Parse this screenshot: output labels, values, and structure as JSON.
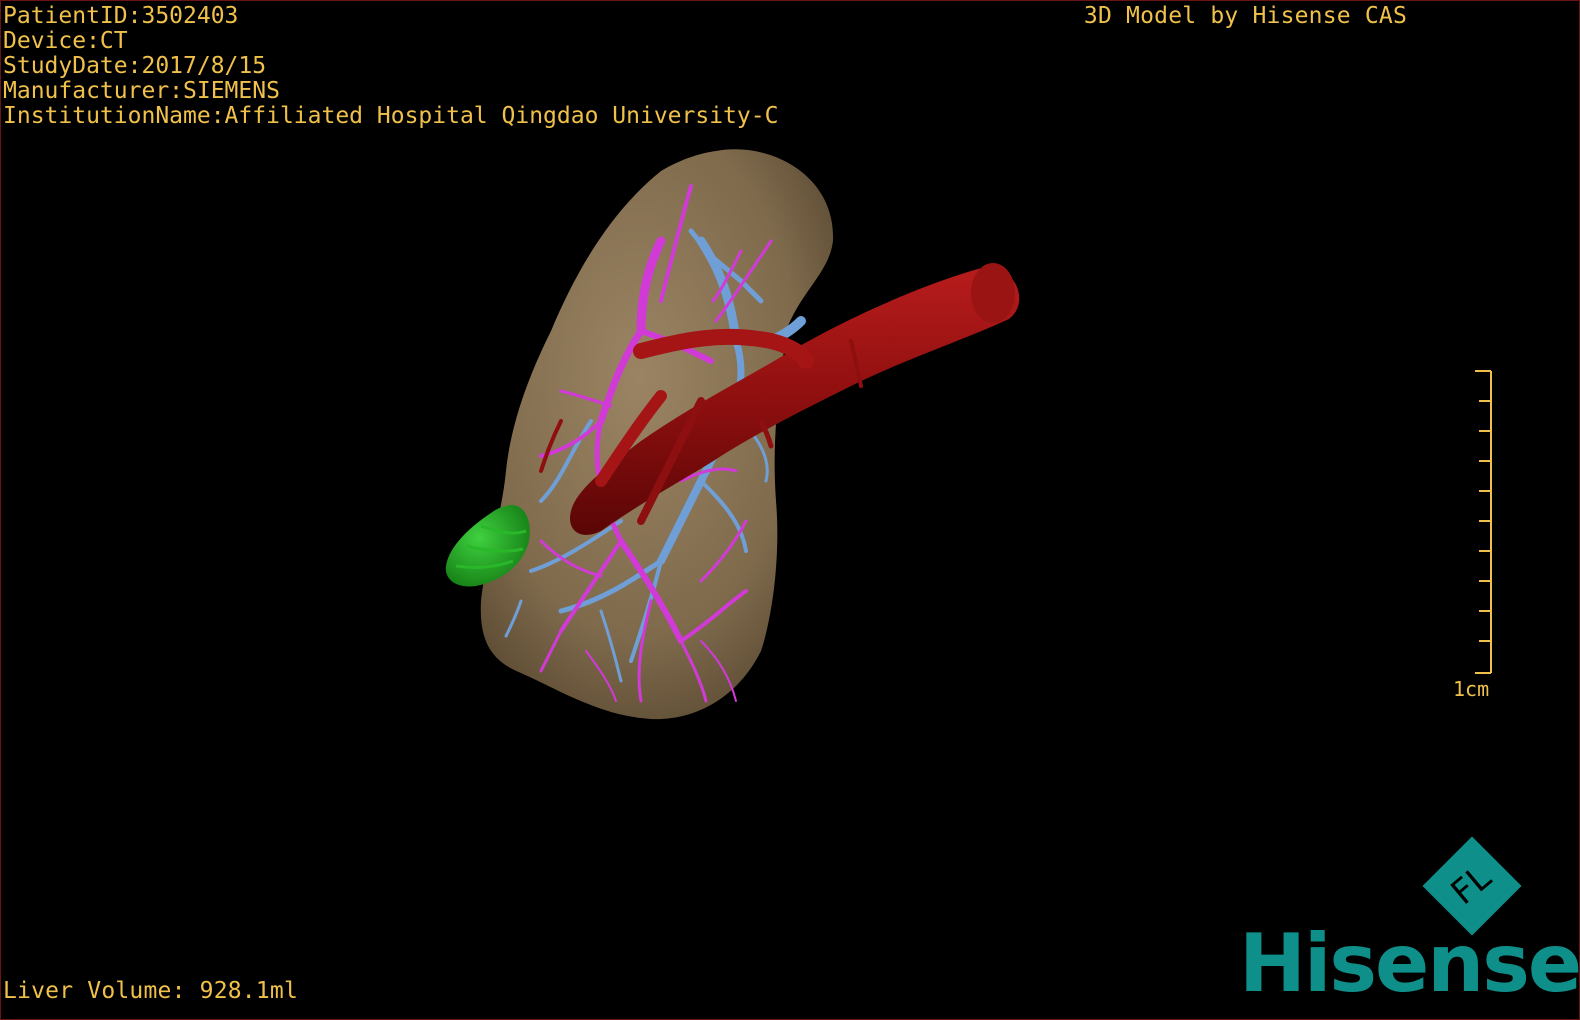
{
  "header": {
    "info_lines": [
      "PatientID:3502403",
      "Device:CT",
      "StudyDate:2017/8/15",
      "Manufacturer:SIEMENS",
      "InstitutionName:Affiliated Hospital Qingdao University-C"
    ],
    "model_credit": "3D Model by Hisense CAS"
  },
  "footer": {
    "liver_volume": "Liver Volume: 928.1ml"
  },
  "scale": {
    "label": "1cm"
  },
  "logo": {
    "word": "Hisense",
    "badge": "FL"
  },
  "colors": {
    "overlay_text": "#f0c14a",
    "liver": "#8a7454",
    "portal_vein": "#d23ad8",
    "hepatic_vein": "#6f9fd6",
    "vena_cava": "#8e0f0f",
    "gallbladder": "#1fa51f",
    "brand": "#0e8f8a"
  }
}
